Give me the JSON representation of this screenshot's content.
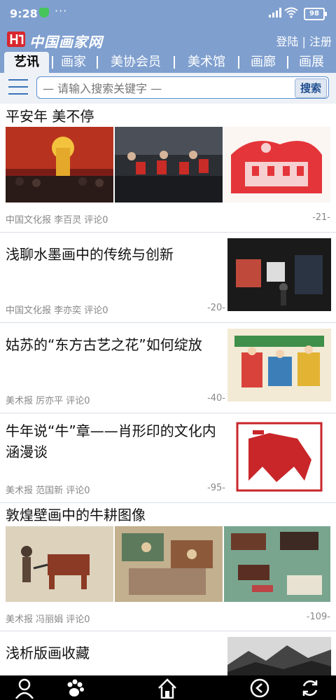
{
  "status": {
    "time": "9:28",
    "battery": "98"
  },
  "header": {
    "login": "登陆",
    "divider": "|",
    "register": "注册"
  },
  "tabs": [
    "艺讯",
    "画家",
    "美协会员",
    "美术馆",
    "画廊",
    "画展"
  ],
  "search": {
    "placeholder": "— 请输入搜索关键字 —",
    "button": "搜索"
  },
  "articles": [
    {
      "title": "平安年 美不停",
      "meta": "中国文化报 李百灵 评论0",
      "num": "-21-"
    },
    {
      "title": "浅聊水墨画中的传统与创新",
      "meta": "中国文化报 李亦奕 评论0",
      "num": "-20-"
    },
    {
      "title": "姑苏的“东方古艺之花”如何绽放",
      "meta": "美术报 厉亦平 评论0",
      "num": "-40-"
    },
    {
      "title": "牛年说“牛”章——肖形印的文化内涵漫谈",
      "title_line1": "牛年说“牛”章——肖形印的文化内",
      "title_line2": "涵漫谈",
      "meta": "美术报 范国新 评论0",
      "num": "-95-"
    },
    {
      "title": "敦煌壁画中的牛耕图像",
      "meta": "美术报 冯丽娟 评论0",
      "num": "-109-"
    },
    {
      "title": "浅析版画收藏"
    }
  ],
  "colors": {
    "header_bg": "#7f9fcf",
    "accent": "#3a72b8"
  }
}
